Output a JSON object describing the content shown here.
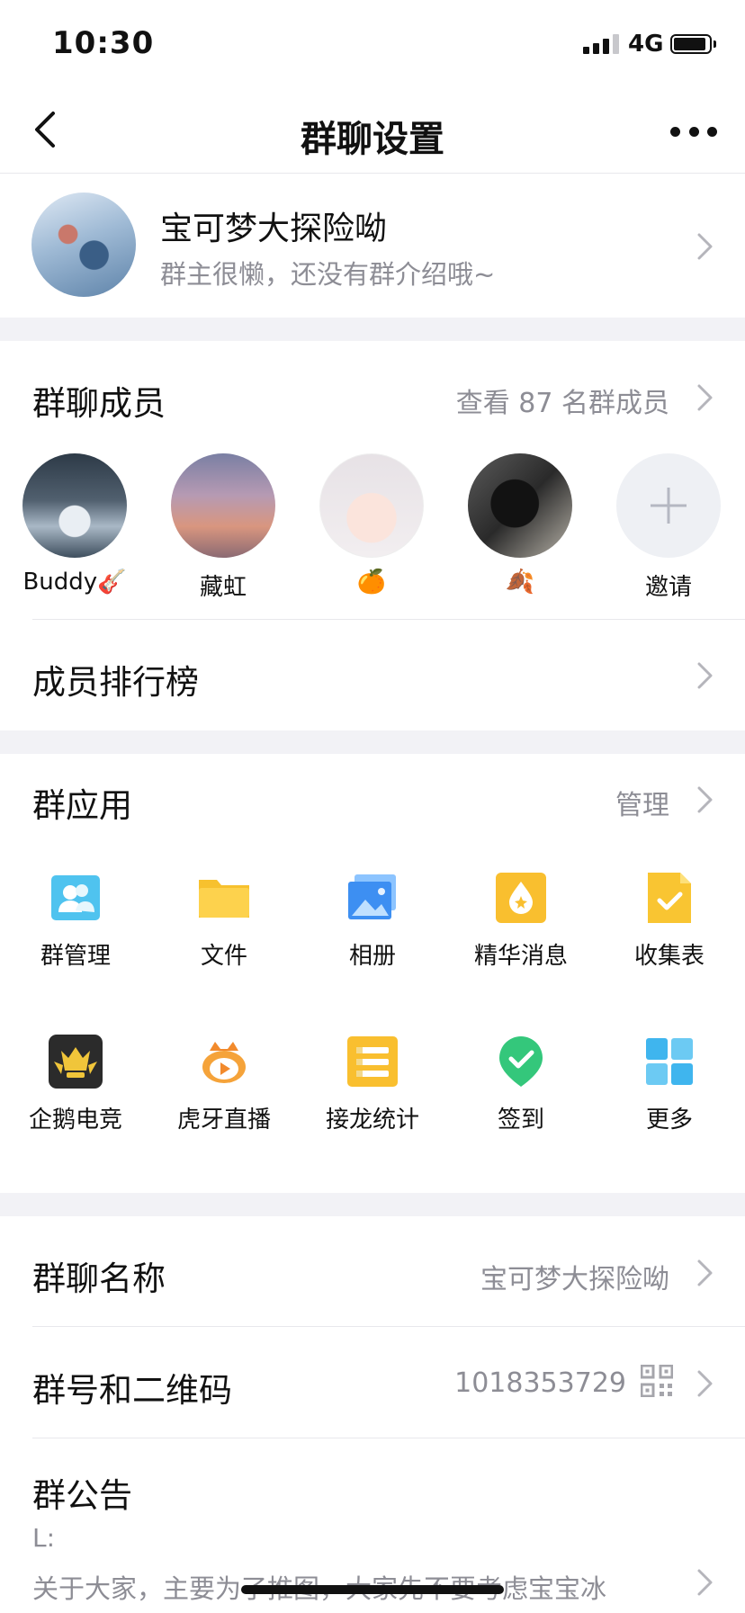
{
  "status_bar": {
    "time": "10:30",
    "network": "4G"
  },
  "nav": {
    "title": "群聊设置"
  },
  "group": {
    "name": "宝可梦大探险呦",
    "description": "群主很懒，还没有群介绍哦~"
  },
  "members": {
    "title": "群聊成员",
    "view_all": "查看 87 名群成员",
    "list": [
      {
        "name": "Buddy🎸"
      },
      {
        "name": "藏虹"
      },
      {
        "name": "🍊"
      },
      {
        "name": "🍂"
      },
      {
        "name": "邀请"
      }
    ]
  },
  "ranking": {
    "label": "成员排行榜"
  },
  "apps": {
    "title": "群应用",
    "manage": "管理",
    "items": [
      {
        "label": "群管理",
        "icon": "group-manage-icon"
      },
      {
        "label": "文件",
        "icon": "folder-icon"
      },
      {
        "label": "相册",
        "icon": "album-icon"
      },
      {
        "label": "精华消息",
        "icon": "essence-icon"
      },
      {
        "label": "收集表",
        "icon": "form-icon"
      },
      {
        "label": "企鹅电竞",
        "icon": "esports-icon"
      },
      {
        "label": "虎牙直播",
        "icon": "huya-icon"
      },
      {
        "label": "接龙统计",
        "icon": "relay-icon"
      },
      {
        "label": "签到",
        "icon": "checkin-icon"
      },
      {
        "label": "更多",
        "icon": "more-apps-icon"
      }
    ]
  },
  "settings": {
    "group_name": {
      "label": "群聊名称",
      "value": "宝可梦大探险呦"
    },
    "group_number": {
      "label": "群号和二维码",
      "value": "1018353729"
    },
    "announcement": {
      "label": "群公告",
      "line1": "L:",
      "line2": "关于大家，主要为了推图，大家先不要考虑宝宝冰"
    }
  },
  "colors": {
    "background": "#ffffff",
    "section_gap": "#f2f2f6",
    "muted_text": "#8d8d95",
    "divider": "#e8e8ec"
  }
}
